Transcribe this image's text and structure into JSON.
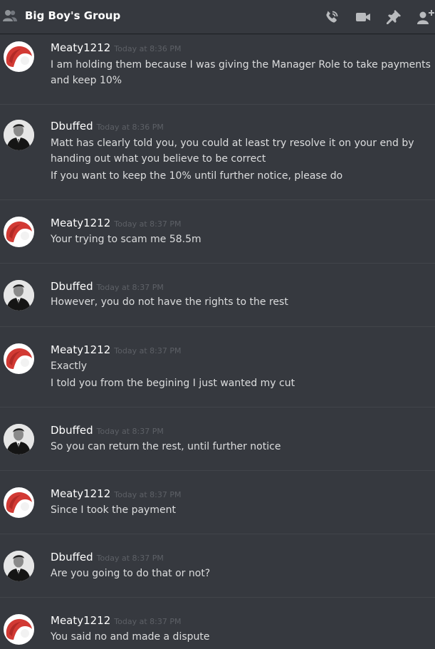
{
  "window": {
    "title": "Big Boy's Group",
    "icons": [
      "group-icon",
      "voice-call-icon",
      "video-call-icon",
      "pin-icon",
      "add-friend-icon"
    ]
  },
  "colors": {
    "background": "#36393f",
    "author": "#ffffff",
    "text": "#dcddde",
    "timestamp": "#5d6066",
    "divider": "#42454a"
  },
  "messages": [
    {
      "author": "Meaty1212",
      "timestamp": "Today at 8:36 PM",
      "avatar": "red-blob-avatar",
      "lines": [
        "I am holding them because I was giving the Manager Role to take payments",
        "and keep 10%"
      ]
    },
    {
      "author": "Dbuffed",
      "timestamp": "Today at 8:36 PM",
      "avatar": "man-in-suit-avatar",
      "lines": [
        "Matt has clearly told you, you could at least try resolve it on your end by",
        "handing out what you believe to be correct",
        "If you want to keep the 10% until further notice, please do"
      ]
    },
    {
      "author": "Meaty1212",
      "timestamp": "Today at 8:37 PM",
      "avatar": "red-blob-avatar",
      "lines": [
        "Your trying to scam me 58.5m"
      ]
    },
    {
      "author": "Dbuffed",
      "timestamp": "Today at 8:37 PM",
      "avatar": "man-in-suit-avatar",
      "lines": [
        "However, you do not have the rights to the rest"
      ]
    },
    {
      "author": "Meaty1212",
      "timestamp": "Today at 8:37 PM",
      "avatar": "red-blob-avatar",
      "lines": [
        "Exactly",
        "I told you from the begining I just wanted my cut"
      ]
    },
    {
      "author": "Dbuffed",
      "timestamp": "Today at 8:37 PM",
      "avatar": "man-in-suit-avatar",
      "lines": [
        "So you can return the rest, until further notice"
      ]
    },
    {
      "author": "Meaty1212",
      "timestamp": "Today at 8:37 PM",
      "avatar": "red-blob-avatar",
      "lines": [
        "Since I took the payment"
      ]
    },
    {
      "author": "Dbuffed",
      "timestamp": "Today at 8:37 PM",
      "avatar": "man-in-suit-avatar",
      "lines": [
        "Are you going to do that or not?"
      ]
    },
    {
      "author": "Meaty1212",
      "timestamp": "Today at 8:37 PM",
      "avatar": "red-blob-avatar",
      "lines": [
        "You said no and made a dispute"
      ]
    }
  ]
}
